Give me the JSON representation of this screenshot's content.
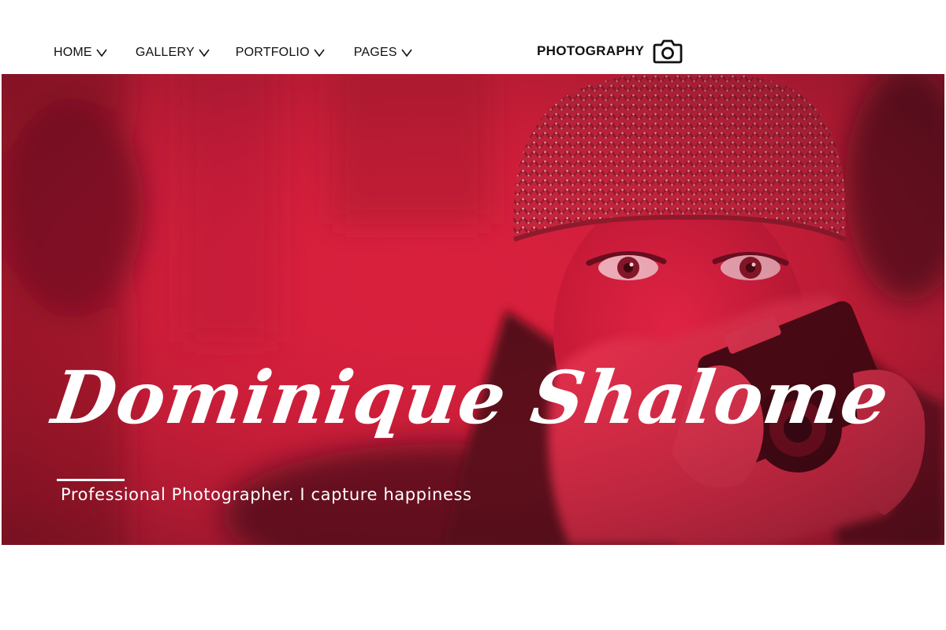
{
  "nav": {
    "items": [
      {
        "label": "HOME"
      },
      {
        "label": "GALLERY"
      },
      {
        "label": "PORTFOLIO"
      },
      {
        "label": "PAGES"
      }
    ],
    "dropdown_icon": "chevron-down-icon"
  },
  "brand": {
    "label": "PHOTOGRAPHY",
    "icon": "camera-icon"
  },
  "hero": {
    "name": "Dominique Shalome",
    "tagline": "Professional Photographer. I capture happiness",
    "image": "woman-with-camera-photo",
    "tint_color": "#d8203d"
  },
  "colors": {
    "accent": "#d8203d",
    "text_dark": "#111111",
    "text_light": "#ffffff",
    "background": "#ffffff"
  }
}
